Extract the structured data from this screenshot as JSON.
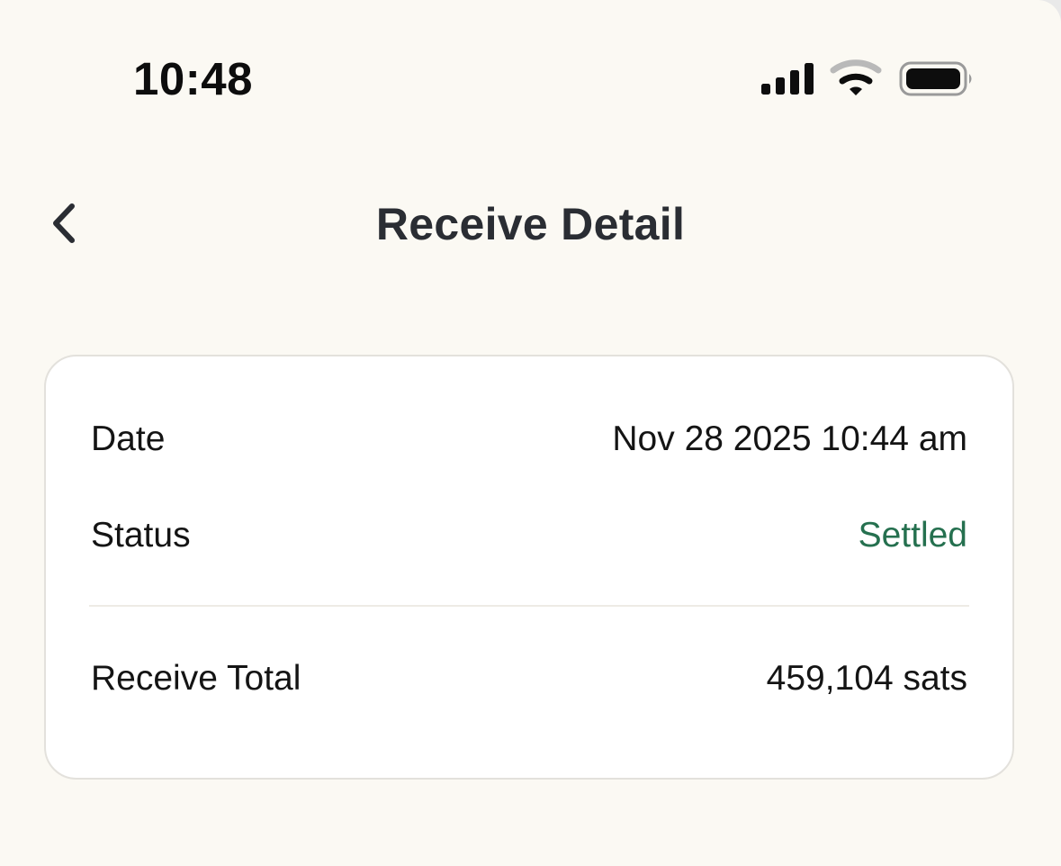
{
  "status_bar": {
    "time": "10:48",
    "icons": [
      "cellular-signal-icon",
      "wifi-icon",
      "battery-icon"
    ]
  },
  "nav": {
    "back_icon": "chevron-left-icon",
    "title": "Receive Detail"
  },
  "details": {
    "date_label": "Date",
    "date_value": "Nov 28 2025 10:44 am",
    "status_label": "Status",
    "status_value": "Settled",
    "total_label": "Receive Total",
    "total_value": "459,104 sats"
  },
  "colors": {
    "background": "#fbf9f3",
    "card": "#ffffff",
    "title_text": "#2a2d33",
    "settled_green": "#25704f"
  }
}
